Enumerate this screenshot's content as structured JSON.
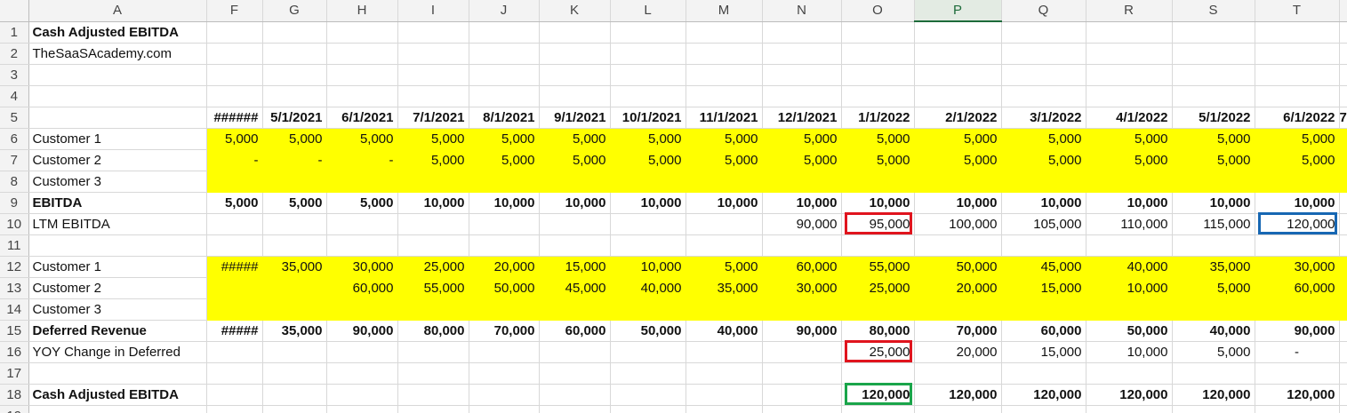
{
  "columns": [
    "A",
    "F",
    "G",
    "H",
    "I",
    "J",
    "K",
    "L",
    "M",
    "N",
    "O",
    "P",
    "Q",
    "R",
    "S",
    "T"
  ],
  "trailing_column": "",
  "rows": [
    {
      "n": "1",
      "label": "Cash Adjusted EBITDA",
      "bold": true,
      "cells": []
    },
    {
      "n": "2",
      "label": "TheSaaSAcademy.com",
      "bold": false,
      "cells": []
    },
    {
      "n": "3",
      "label": "",
      "cells": []
    },
    {
      "n": "4",
      "label": "",
      "cells": []
    },
    {
      "n": "5",
      "label": "",
      "bold": true,
      "cells": [
        "######",
        "5/1/2021",
        "6/1/2021",
        "7/1/2021",
        "8/1/2021",
        "9/1/2021",
        "10/1/2021",
        "11/1/2021",
        "12/1/2021",
        "1/1/2022",
        "2/1/2022",
        "3/1/2022",
        "4/1/2022",
        "5/1/2022",
        "6/1/2022"
      ],
      "overflow": "7"
    },
    {
      "n": "6",
      "label": "Customer 1",
      "yellow": true,
      "cells": [
        "5,000",
        "5,000",
        "5,000",
        "5,000",
        "5,000",
        "5,000",
        "5,000",
        "5,000",
        "5,000",
        "5,000",
        "5,000",
        "5,000",
        "5,000",
        "5,000",
        "5,000"
      ]
    },
    {
      "n": "7",
      "label": "Customer 2",
      "yellow": true,
      "cells": [
        "-",
        "-",
        "-",
        "5,000",
        "5,000",
        "5,000",
        "5,000",
        "5,000",
        "5,000",
        "5,000",
        "5,000",
        "5,000",
        "5,000",
        "5,000",
        "5,000"
      ]
    },
    {
      "n": "8",
      "label": "Customer 3",
      "yellow": true,
      "cells": []
    },
    {
      "n": "9",
      "label": "EBITDA",
      "bold": true,
      "topline": true,
      "cells": [
        "5,000",
        "5,000",
        "5,000",
        "10,000",
        "10,000",
        "10,000",
        "10,000",
        "10,000",
        "10,000",
        "10,000",
        "10,000",
        "10,000",
        "10,000",
        "10,000",
        "10,000"
      ]
    },
    {
      "n": "10",
      "label": "LTM EBITDA",
      "cells": [
        "",
        "",
        "",
        "",
        "",
        "",
        "",
        "",
        "90,000",
        "95,000",
        "100,000",
        "105,000",
        "110,000",
        "115,000",
        "120,000"
      ]
    },
    {
      "n": "11",
      "label": "",
      "cells": []
    },
    {
      "n": "12",
      "label": "Customer 1",
      "yellow": true,
      "cells": [
        "#####",
        "35,000",
        "30,000",
        "25,000",
        "20,000",
        "15,000",
        "10,000",
        "5,000",
        "60,000",
        "55,000",
        "50,000",
        "45,000",
        "40,000",
        "35,000",
        "30,000"
      ]
    },
    {
      "n": "13",
      "label": "Customer 2",
      "yellow": true,
      "cells": [
        "",
        "",
        "60,000",
        "55,000",
        "50,000",
        "45,000",
        "40,000",
        "35,000",
        "30,000",
        "25,000",
        "20,000",
        "15,000",
        "10,000",
        "5,000",
        "60,000"
      ]
    },
    {
      "n": "14",
      "label": "Customer 3",
      "yellow": true,
      "cells": []
    },
    {
      "n": "15",
      "label": "Deferred Revenue",
      "bold": true,
      "topline": true,
      "cells": [
        "#####",
        "35,000",
        "90,000",
        "80,000",
        "70,000",
        "60,000",
        "50,000",
        "40,000",
        "90,000",
        "80,000",
        "70,000",
        "60,000",
        "50,000",
        "40,000",
        "90,000"
      ]
    },
    {
      "n": "16",
      "label": "YOY Change in Deferred",
      "cells": [
        "",
        "",
        "",
        "",
        "",
        "",
        "",
        "",
        "",
        "25,000",
        "20,000",
        "15,000",
        "10,000",
        "5,000",
        "-"
      ]
    },
    {
      "n": "17",
      "label": "",
      "cells": []
    },
    {
      "n": "18",
      "label": "Cash Adjusted EBITDA",
      "bold": true,
      "cells": [
        "",
        "",
        "",
        "",
        "",
        "",
        "",
        "",
        "",
        "120,000",
        "120,000",
        "120,000",
        "120,000",
        "120,000",
        "120,000"
      ]
    },
    {
      "n": "19",
      "label": "",
      "cells": []
    }
  ],
  "selected_column": "P",
  "highlights": [
    {
      "row": "10",
      "col": "O",
      "color": "red"
    },
    {
      "row": "10",
      "col": "T",
      "color": "blue"
    },
    {
      "row": "16",
      "col": "O",
      "color": "red"
    },
    {
      "row": "18",
      "col": "O",
      "color": "green"
    }
  ]
}
